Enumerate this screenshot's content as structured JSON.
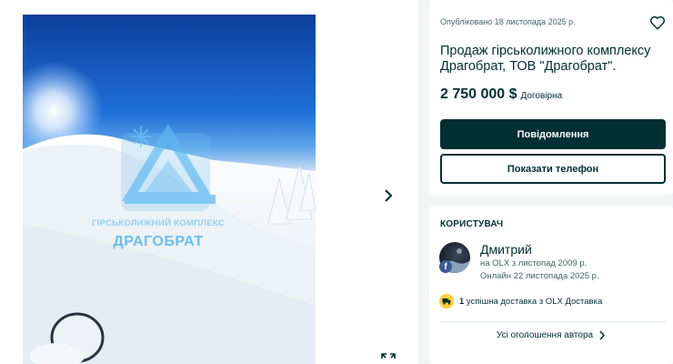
{
  "gallery": {
    "photo_alt": "ski resort photo",
    "watermark_line1": "ГІРСЬКОЛИЖНИЙ КОМПЛЕКС",
    "watermark_line2": "ДРАГОБРАТ",
    "next_icon": "chevron-right-icon",
    "fullscreen_icon": "expand-icon"
  },
  "listing": {
    "published": "Опубліковано 18 листопада 2025 р.",
    "title": "Продаж гірськолижного комплексу Драгобрат, ТОВ \"Драгобрат\".",
    "price": "2 750 000 $",
    "negotiable": "Договірна",
    "message_button": "Повідомлення",
    "phone_button": "Показати телефон",
    "favorite_icon": "heart-icon"
  },
  "user": {
    "section_title": "КОРИСТУВАЧ",
    "name": "Дмитрий",
    "member_since": "на OLX з листопад 2009 р.",
    "last_online": "Онлайн 22 листопада 2025 р.",
    "delivery_count": "1",
    "delivery_text": " успішна доставка з OLX Доставка",
    "all_ads_link": "Усі оголошення автора",
    "badge": "f"
  },
  "colors": {
    "primary": "#002f34",
    "delivery_badge": "#ffce32",
    "facebook": "#3b5998",
    "background": "#f2f4f5"
  }
}
